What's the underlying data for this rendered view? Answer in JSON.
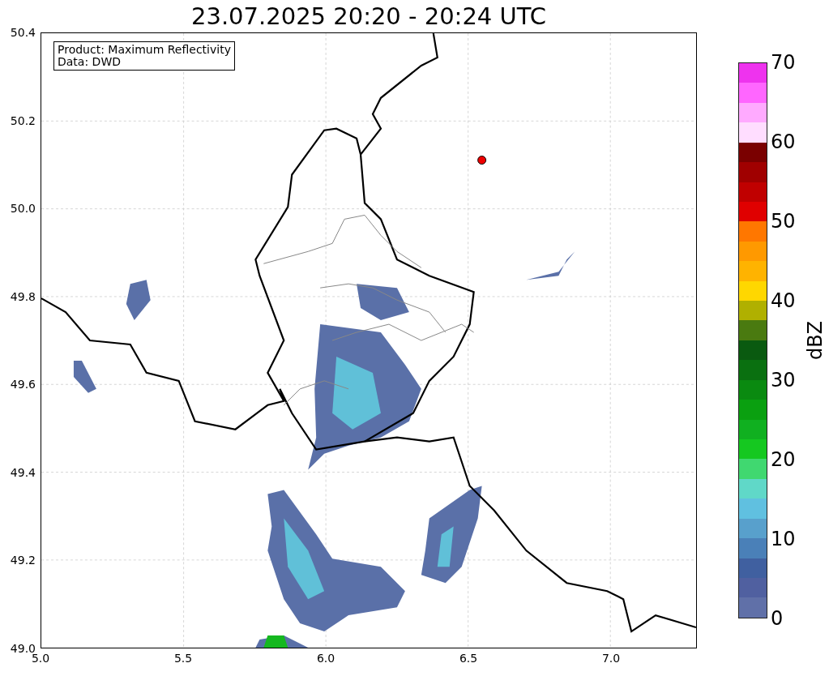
{
  "title": "23.07.2025 20:20 - 20:24 UTC",
  "legend": [
    "Product: Maximum Reflectivity",
    "Data: DWD"
  ],
  "y_ticks": [
    "50.4",
    "50.2",
    "50.0",
    "49.8",
    "49.6",
    "49.4",
    "49.2",
    "49.0"
  ],
  "x_ticks": [
    "5.0",
    "5.5",
    "6.0",
    "6.5",
    "7.0"
  ],
  "colorbar": {
    "label": "dBZ",
    "ticks": [
      "70",
      "60",
      "50",
      "40",
      "30",
      "20",
      "10",
      "0"
    ],
    "bands": [
      {
        "color": "#ee33ee"
      },
      {
        "color": "#ff66ff"
      },
      {
        "color": "#ffaaff"
      },
      {
        "color": "#ffddff"
      },
      {
        "color": "#7a0000"
      },
      {
        "color": "#a00000"
      },
      {
        "color": "#c00000"
      },
      {
        "color": "#e00000"
      },
      {
        "color": "#ff7700"
      },
      {
        "color": "#ff9900"
      },
      {
        "color": "#ffb300"
      },
      {
        "color": "#ffd700"
      },
      {
        "color": "#b0b000"
      },
      {
        "color": "#4a7a10"
      },
      {
        "color": "#0a5a10"
      },
      {
        "color": "#0a7010"
      },
      {
        "color": "#0a8a10"
      },
      {
        "color": "#0aa010"
      },
      {
        "color": "#10b020"
      },
      {
        "color": "#15c820"
      },
      {
        "color": "#40d870"
      },
      {
        "color": "#60d8c8"
      },
      {
        "color": "#60c0e0"
      },
      {
        "color": "#58a0cc"
      },
      {
        "color": "#4a80b8"
      },
      {
        "color": "#4060a0"
      },
      {
        "color": "#5060a0"
      },
      {
        "color": "#6070a8"
      }
    ]
  }
}
